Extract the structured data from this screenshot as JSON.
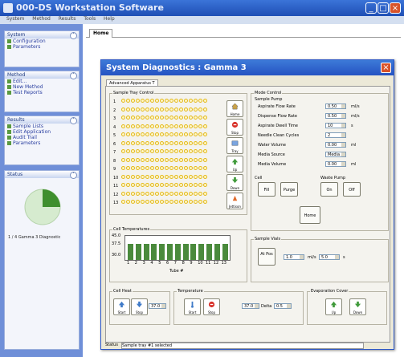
{
  "app": {
    "title": "000-DS Workstation Software",
    "menu": [
      "System",
      "Method",
      "Results",
      "Tools",
      "Help"
    ]
  },
  "left_pane": {
    "system": {
      "header": "System",
      "items": [
        "Configuration",
        "Parameters"
      ]
    },
    "method": {
      "header": "Method",
      "items": [
        "Edit...",
        "New Method",
        "Test Reports"
      ]
    },
    "results": {
      "header": "Results",
      "items": [
        "Sample Lists",
        "Edit Application",
        "Audit Trail",
        "Parameters"
      ]
    },
    "status": {
      "header": "Status",
      "caption": "1 / 4 Gamma 3 Diagnostic"
    }
  },
  "main": {
    "tab": "Home"
  },
  "dialog": {
    "title": "System Diagnostics : Gamma 3",
    "tab": "Advanced Apparatus T",
    "tray": {
      "label": "Sample Tray Control",
      "rows": [
        "1",
        "2",
        "3",
        "4",
        "5",
        "6",
        "7",
        "8",
        "9",
        "10",
        "11",
        "12",
        "13"
      ],
      "buttons": [
        "Home",
        "Stop",
        "Tray",
        "Up",
        "Down",
        "Jettison"
      ]
    },
    "mode": {
      "label": "Mode Control",
      "sample_pump": "Sample Pump",
      "fields": [
        {
          "label": "Aspirate Flow Rate",
          "value": "0.50",
          "unit": "ml/s"
        },
        {
          "label": "Dispense Flow Rate",
          "value": "0.50",
          "unit": "ml/s"
        },
        {
          "label": "Aspirate Dwell Time",
          "value": "10",
          "unit": "s"
        },
        {
          "label": "Needle Clean Cycles",
          "value": "2",
          "unit": ""
        },
        {
          "label": "Water Volume",
          "value": "0.00",
          "unit": "ml"
        },
        {
          "label": "Media Source",
          "value": "Media A",
          "unit": ""
        },
        {
          "label": "Media Volume",
          "value": "0.00",
          "unit": "ml"
        }
      ],
      "cell": {
        "label": "Cell",
        "fill": "Fill",
        "purge": "Purge"
      },
      "waste_pump": {
        "label": "Waste Pump",
        "on": "On",
        "off": "Off"
      },
      "home": "Home"
    },
    "cell_temp": {
      "label": "Cell Temperatures",
      "axis": "Tube #",
      "y_label": "45.0",
      "y_values": [
        "37.5",
        "30.0"
      ],
      "ticks": [
        "1",
        "2",
        "3",
        "4",
        "5",
        "6",
        "7",
        "8",
        "9",
        "10",
        "11",
        "12",
        "13"
      ]
    },
    "sample_vials": {
      "label": "Sample Vials",
      "button": "At Pos",
      "value_a": "1.0",
      "mid": "ml/s",
      "value_b": "5.0",
      "unit": "s"
    },
    "cell_heat": {
      "label": "Cell Heat",
      "start": "Start",
      "stop": "Stop",
      "value": "37.0"
    },
    "temperature": {
      "label": "Temperature",
      "start": "Start",
      "stop": "Stop",
      "value_a": "37.0",
      "mid": "Delta",
      "value_b": "0.5"
    },
    "evaporation": {
      "label": "Evaporation Cover",
      "up": "Up",
      "down": "Down"
    },
    "status": {
      "label": "Status",
      "text": "Sample tray #1 selected"
    }
  },
  "colors": {
    "titlebar": "#2553c2",
    "leftpane": "#6f8fd8",
    "dialog_bg": "#ece9d8",
    "tray_dot": "#e3b91a",
    "bar": "#4a8a3c"
  }
}
